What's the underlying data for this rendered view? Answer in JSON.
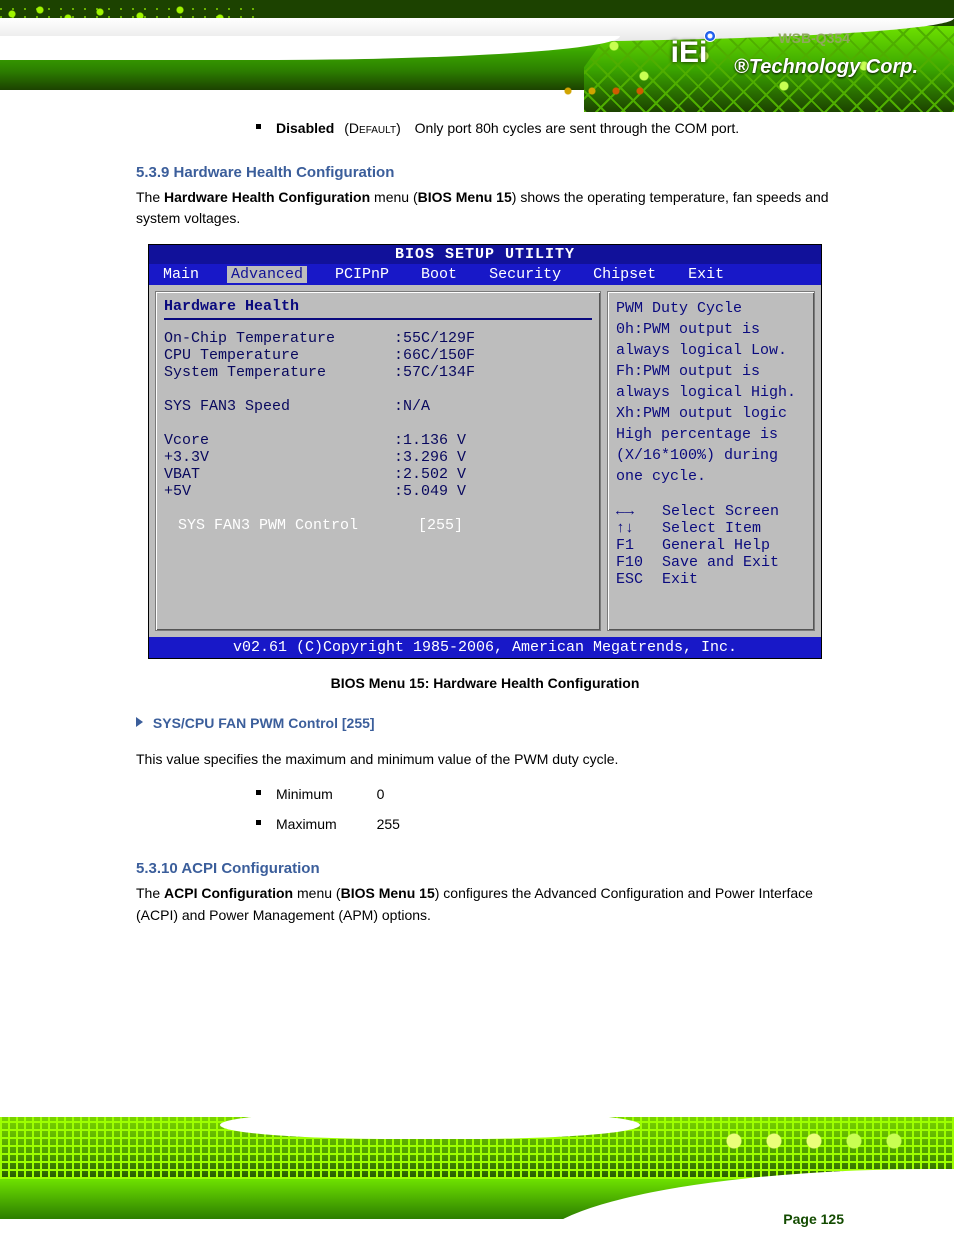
{
  "header_sub": "WSB-Q354",
  "li_disabled_label": "Disabled",
  "li_disabled_default": "(Default)",
  "li_disabled_text": "Only port 80h cycles are sent through the COM port.",
  "section1_title": "5.3.9 Hardware Health Configuration",
  "section1_p1": "The Hardware Health Configuration menu (BIOS Menu 15) shows the operating temperature, fan speeds and system voltages.",
  "figure_caption": "BIOS Menu 15: Hardware Health Configuration",
  "opt_heading": "SYS/CPU FAN PWM Control [255]",
  "opt_p": "This value specifies the maximum and minimum value of the PWM duty cycle.",
  "opt_min_label": "Minimum",
  "opt_min_val": "0",
  "opt_max_label": "Maximum",
  "opt_max_val": "255",
  "section2_title": "5.3.10 ACPI Configuration",
  "section2_p": "The ACPI Configuration menu (BIOS Menu 15) configures the Advanced Configuration and Power Interface (ACPI) and Power Management (APM) options.",
  "page_number": "Page 125",
  "bios": {
    "title": "BIOS SETUP UTILITY",
    "tabs": [
      "Main",
      "Advanced",
      "PCIPnP",
      "Boot",
      "Security",
      "Chipset",
      "Exit"
    ],
    "active_tab": "Advanced",
    "panel_title": "Hardware Health",
    "rows": [
      {
        "lbl": "On-Chip Temperature",
        "val": ":55C/129F"
      },
      {
        "lbl": "CPU Temperature",
        "val": ":66C/150F"
      },
      {
        "lbl": "System Temperature",
        "val": ":57C/134F"
      }
    ],
    "fan_row": {
      "lbl": "SYS FAN3 Speed",
      "val": ":N/A"
    },
    "volt_rows": [
      {
        "lbl": "Vcore",
        "val": ":1.136 V"
      },
      {
        "lbl": "+3.3V",
        "val": ":3.296 V"
      },
      {
        "lbl": "VBAT",
        "val": ":2.502 V"
      },
      {
        "lbl": "+5V",
        "val": ":5.049 V"
      }
    ],
    "sel_row": {
      "lbl": "SYS FAN3 PWM Control",
      "val": "[255]"
    },
    "help": [
      "PWM Duty Cycle",
      "0h:PWM output is",
      "always logical Low.",
      "",
      "Fh:PWM output is",
      "always logical High.",
      "",
      "Xh:PWM output logic",
      "High percentage is",
      "(X/16*100%) during",
      "one cycle."
    ],
    "keys": [
      {
        "k": "←→",
        "d": "Select Screen"
      },
      {
        "k": "↑↓",
        "d": "Select Item"
      },
      {
        "k": "F1",
        "d": "General Help"
      },
      {
        "k": "F10",
        "d": "Save and Exit"
      },
      {
        "k": "ESC",
        "d": "Exit"
      }
    ],
    "footer": "v02.61 (C)Copyright 1985-2006, American Megatrends, Inc."
  }
}
